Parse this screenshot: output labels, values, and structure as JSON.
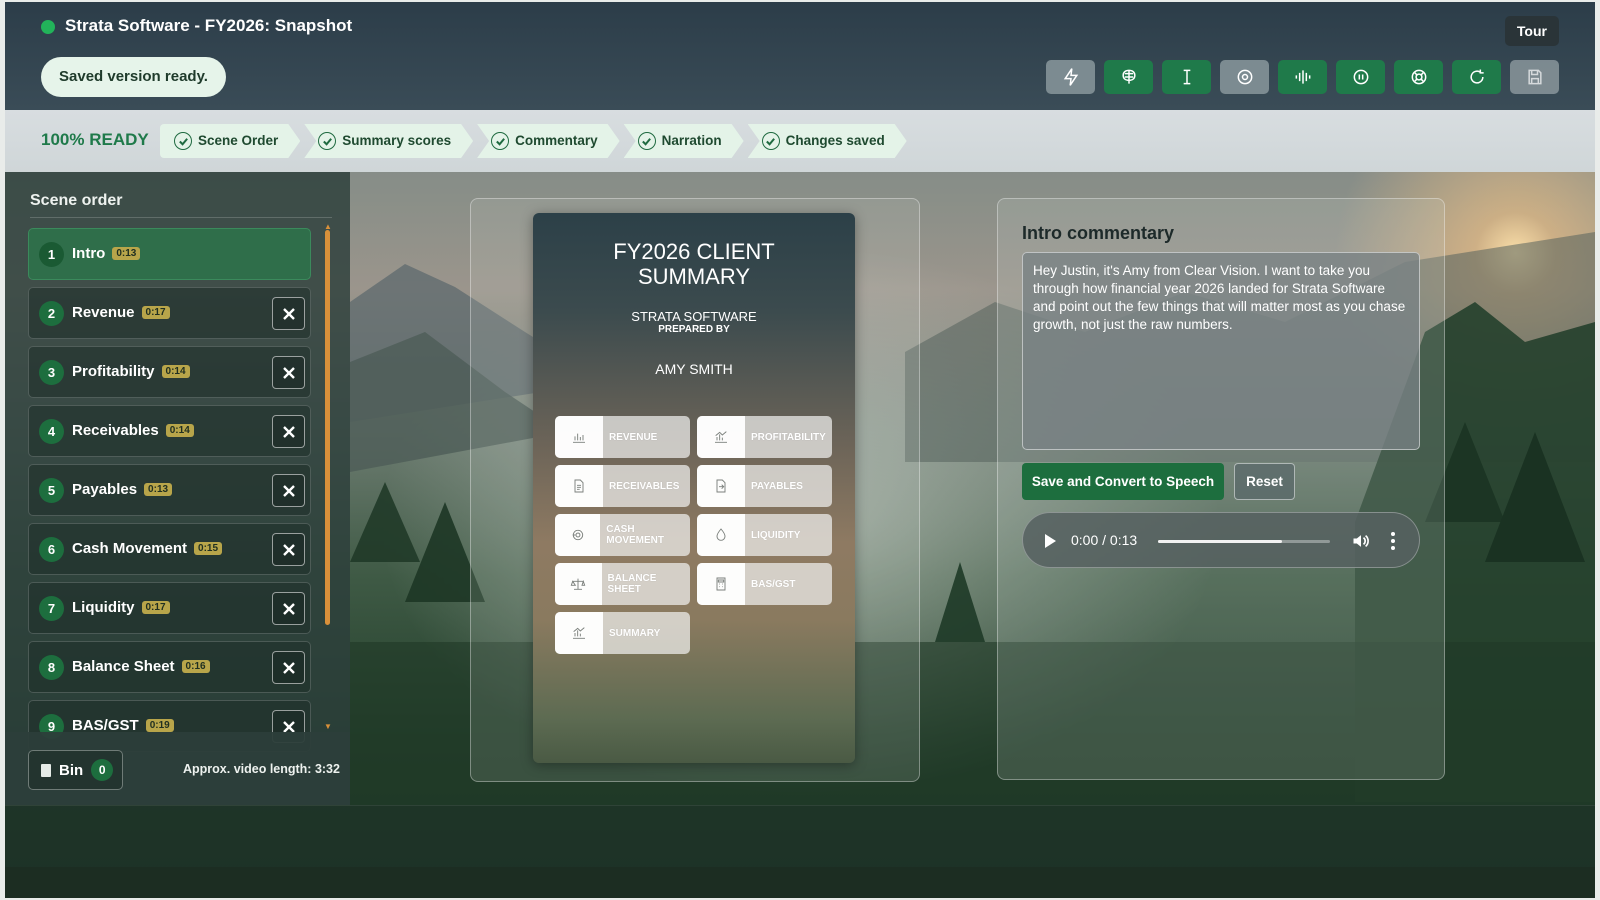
{
  "app": {
    "title": "Strata Software - FY2026: Snapshot",
    "status_pill": "Saved version ready.",
    "tour_label": "Tour",
    "accent": "#1d6e3e",
    "toolbar": [
      {
        "name": "lightning-icon",
        "style": "grey"
      },
      {
        "name": "brain-icon",
        "style": "green"
      },
      {
        "name": "text-cursor-icon",
        "style": "green"
      },
      {
        "name": "settings-icon",
        "style": "grey"
      },
      {
        "name": "audio-waveform-icon",
        "style": "green"
      },
      {
        "name": "record-icon",
        "style": "green"
      },
      {
        "name": "lifebuoy-icon",
        "style": "green"
      },
      {
        "name": "refresh-icon",
        "style": "green"
      },
      {
        "name": "save-icon",
        "style": "disabled"
      }
    ]
  },
  "progress": {
    "ready_label": "100% READY",
    "steps": [
      "Scene Order",
      "Summary scores",
      "Commentary",
      "Narration",
      "Changes saved"
    ]
  },
  "sidebar": {
    "title": "Scene order",
    "scenes": [
      {
        "num": "1",
        "label": "Intro",
        "duration": "0:13",
        "active": true
      },
      {
        "num": "2",
        "label": "Revenue",
        "duration": "0:17"
      },
      {
        "num": "3",
        "label": "Profitability",
        "duration": "0:14"
      },
      {
        "num": "4",
        "label": "Receivables",
        "duration": "0:14"
      },
      {
        "num": "5",
        "label": "Payables",
        "duration": "0:13"
      },
      {
        "num": "6",
        "label": "Cash Movement",
        "duration": "0:15"
      },
      {
        "num": "7",
        "label": "Liquidity",
        "duration": "0:17"
      },
      {
        "num": "8",
        "label": "Balance Sheet",
        "duration": "0:16"
      },
      {
        "num": "9",
        "label": "BAS/GST",
        "duration": "0:19"
      }
    ],
    "bin_label": "Bin",
    "bin_count": "0",
    "approx_length": "Approx. video length: 3:32"
  },
  "slide": {
    "title_line1": "FY2026 CLIENT",
    "title_line2": "SUMMARY",
    "company": "STRATA SOFTWARE",
    "prepared_by": "PREPARED BY",
    "preparer": "AMY SMITH",
    "tiles": [
      {
        "label": "REVENUE",
        "icon": "chart-icon"
      },
      {
        "label": "PROFITABILITY",
        "icon": "trend-chart-icon"
      },
      {
        "label": "RECEIVABLES",
        "icon": "document-icon"
      },
      {
        "label": "PAYABLES",
        "icon": "document-arrow-icon"
      },
      {
        "label": "CASH MOVEMENT",
        "icon": "coins-icon"
      },
      {
        "label": "LIQUIDITY",
        "icon": "droplet-icon"
      },
      {
        "label": "BALANCE SHEET",
        "icon": "scale-icon"
      },
      {
        "label": "BAS/GST",
        "icon": "calculator-icon"
      },
      {
        "label": "SUMMARY",
        "icon": "summary-chart-icon"
      }
    ]
  },
  "commentary": {
    "title": "Intro commentary",
    "text": "Hey Justin, it's Amy from Clear Vision. I want to take you through how financial year 2026 landed for Strata Software and point out the few things that will matter most as you chase growth, not just the raw numbers.",
    "save_label": "Save and Convert to Speech",
    "reset_label": "Reset",
    "audio_time": "0:00 / 0:13",
    "audio_progress": 0.72
  }
}
